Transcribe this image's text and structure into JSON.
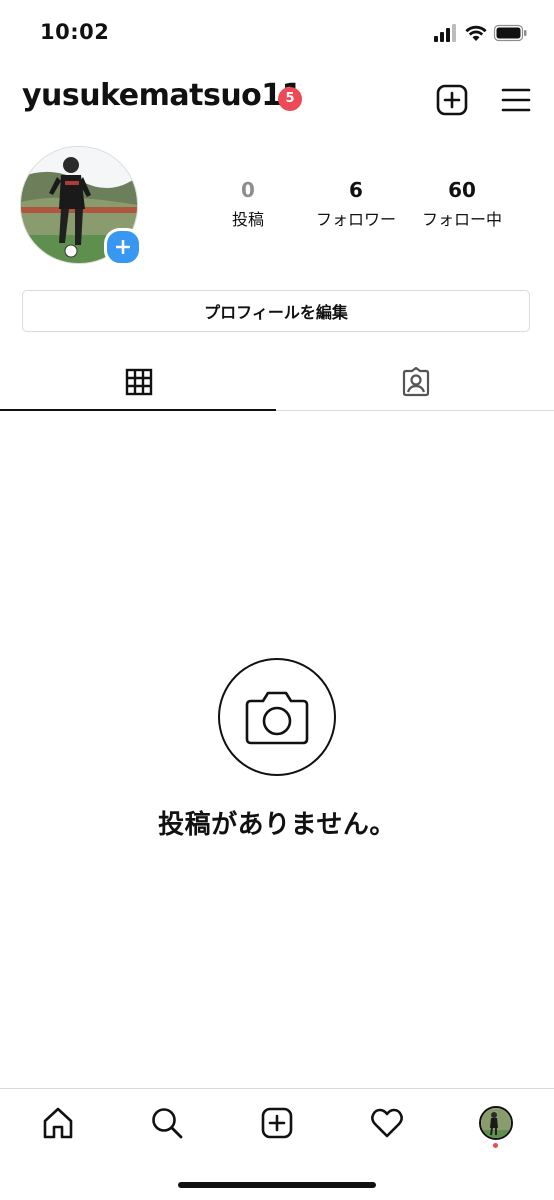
{
  "status_bar": {
    "time": "10:02",
    "icons": [
      "signal-icon",
      "wifi-icon",
      "battery-icon"
    ]
  },
  "header": {
    "username": "yusukematsuo11",
    "notification_count": "5",
    "icons": [
      "new-post-icon",
      "menu-icon"
    ]
  },
  "profile": {
    "avatar_icon": "profile-photo",
    "add_story_icon": "plus-icon",
    "stats": {
      "posts": {
        "value": "0",
        "label": "投稿"
      },
      "followers": {
        "value": "6",
        "label": "フォロワー"
      },
      "following": {
        "value": "60",
        "label": "フォロー中"
      }
    },
    "edit_button_label": "プロフィールを編集"
  },
  "tabs": {
    "items": [
      {
        "icon": "grid-icon",
        "active": true
      },
      {
        "icon": "tagged-icon",
        "active": false
      }
    ]
  },
  "empty_state": {
    "icon": "camera-icon",
    "message": "投稿がありません。"
  },
  "bottom_nav": {
    "items": [
      "home-icon",
      "search-icon",
      "new-post-icon",
      "heart-icon",
      "profile-avatar"
    ]
  },
  "colors": {
    "badge": "#ed4956",
    "accent_blue": "#3897f0",
    "divider": "#dbdbdb",
    "muted": "#8e8e8e"
  }
}
